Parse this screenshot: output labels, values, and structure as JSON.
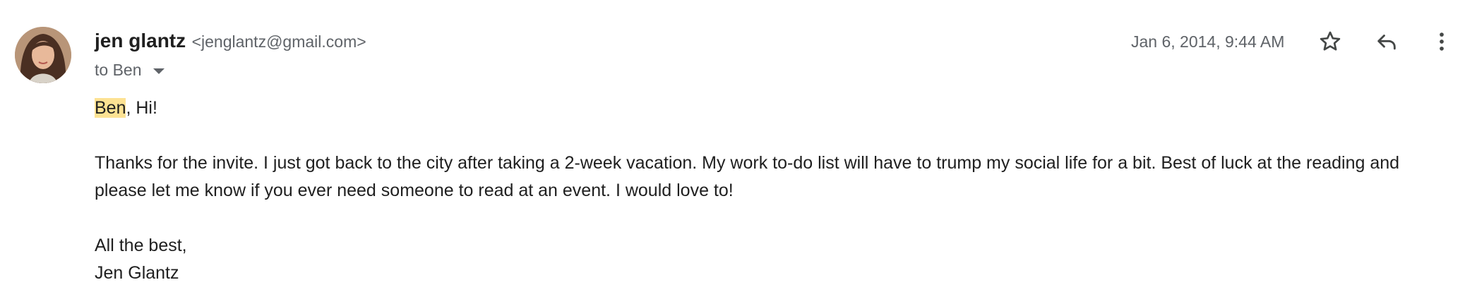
{
  "sender": {
    "name": "jen glantz",
    "email": "<jenglantz@gmail.com>"
  },
  "recipient": {
    "label": "to Ben"
  },
  "date": "Jan 6, 2014, 9:44 AM",
  "actions": {
    "star_icon": "star-outline",
    "reply_icon": "reply-arrow",
    "more_icon": "vertical-dots"
  },
  "message": {
    "greeting_highlight": "Ben",
    "greeting_rest": ", Hi!",
    "paragraph_line1": "Thanks for the invite. I just got back to the city after taking a 2-week vacation. My work to-do list will have to trump my social life for a bit. Best of luck at the reading and",
    "paragraph_line2": "please let me know if you ever need someone to read at an event. I would love to!",
    "closing": "All the best,",
    "signature": "Jen Glantz"
  },
  "colors": {
    "highlight": "#fde293",
    "secondary_text": "#5f6368",
    "primary_text": "#1f1f1f"
  }
}
